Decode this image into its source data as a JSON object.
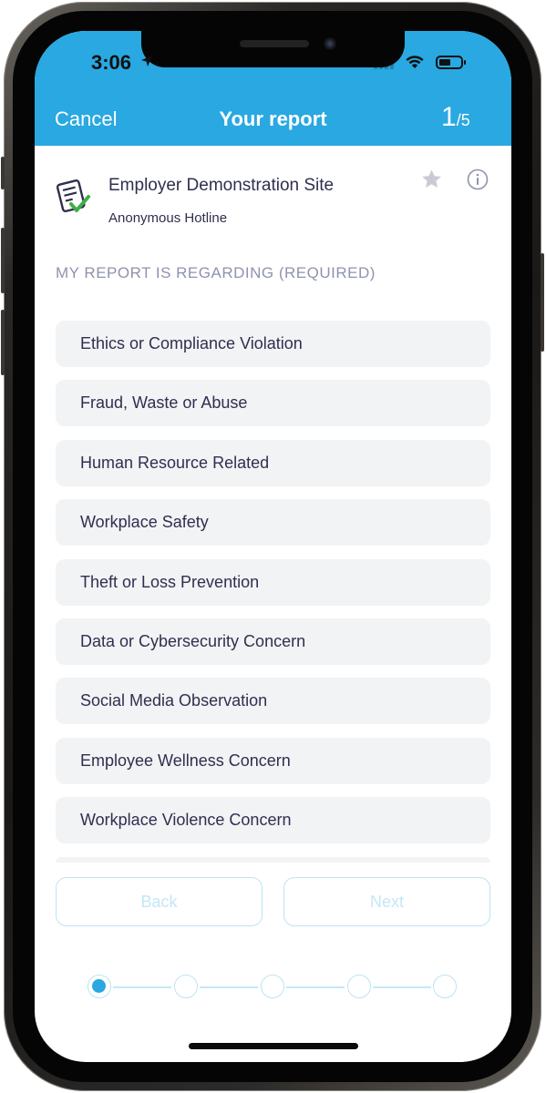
{
  "status_bar": {
    "time": "3:06",
    "icons": [
      "location-arrow-icon",
      "signal-icon",
      "wifi-icon",
      "battery-icon"
    ]
  },
  "nav": {
    "cancel_label": "Cancel",
    "title": "Your report",
    "step_current": "1",
    "step_total": "/5"
  },
  "site": {
    "name": "Employer Demonstration Site",
    "subtitle": "Anonymous Hotline",
    "icon": "report-checklist-icon"
  },
  "section_label": "MY REPORT IS REGARDING (REQUIRED)",
  "options": [
    {
      "label": "Ethics or Compliance Violation"
    },
    {
      "label": "Fraud, Waste or Abuse"
    },
    {
      "label": "Human Resource Related"
    },
    {
      "label": "Workplace Safety"
    },
    {
      "label": "Theft or Loss Prevention"
    },
    {
      "label": "Data or Cybersecurity Concern"
    },
    {
      "label": "Social Media Observation"
    },
    {
      "label": "Employee Wellness Concern"
    },
    {
      "label": "Workplace Violence Concern"
    }
  ],
  "footer": {
    "back_label": "Back",
    "next_label": "Next"
  },
  "stepper": {
    "steps": 5,
    "current_step": 1
  },
  "colors": {
    "accent": "#29a8e1",
    "text": "#2f2f4f",
    "muted": "#8f93ad",
    "option_bg": "#f2f3f5",
    "disabled": "#c3e6f7"
  }
}
